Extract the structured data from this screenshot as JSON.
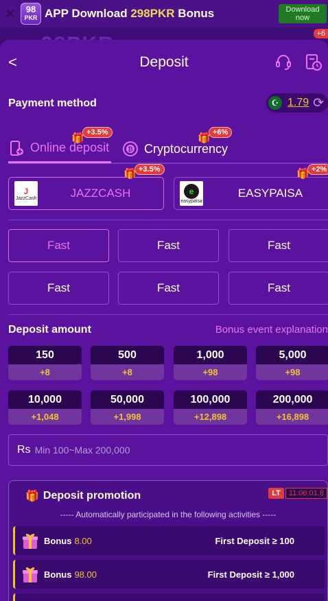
{
  "appbar": {
    "logo_top": "98",
    "logo_bottom": "PKR",
    "title_prefix": "APP Download ",
    "title_highlight": "298PKR",
    "title_suffix": " Bonus",
    "download_button": "Download now"
  },
  "backdrop": {
    "brand": "98PKR",
    "badge": "+6"
  },
  "header": {
    "title": "Deposit"
  },
  "payment": {
    "label": "Payment method",
    "rate": "1.79"
  },
  "methods": [
    {
      "label": "Online deposit",
      "badge": "+3.5%",
      "active": true
    },
    {
      "label": "Cryptocurrency",
      "badge": "+6%",
      "active": false
    }
  ],
  "channels": [
    {
      "name": "JAZZCASH",
      "logo_text": "JazzCash",
      "badge": "+3.5%"
    },
    {
      "name": "EASYPAISA",
      "logo_text": "easypaisa",
      "badge": "+2%"
    }
  ],
  "speeds": [
    "Fast",
    "Fast",
    "Fast",
    "Fast",
    "Fast",
    "Fast"
  ],
  "deposit_amount": {
    "label": "Deposit amount",
    "link": "Bonus event explanation",
    "options": [
      {
        "value": "150",
        "bonus": "+8"
      },
      {
        "value": "500",
        "bonus": "+8"
      },
      {
        "value": "1,000",
        "bonus": "+98"
      },
      {
        "value": "5,000",
        "bonus": "+98"
      },
      {
        "value": "10,000",
        "bonus": "+1,048"
      },
      {
        "value": "50,000",
        "bonus": "+1,998"
      },
      {
        "value": "100,000",
        "bonus": "+12,898"
      },
      {
        "value": "200,000",
        "bonus": "+16,898"
      }
    ]
  },
  "amount_input": {
    "currency": "Rs",
    "placeholder": "Min 100~Max 200,000"
  },
  "promotion": {
    "title": "Deposit promotion",
    "timer_label": "LT",
    "timer": "11:06:01.8",
    "subtitle": "----- Automatically participated in the following activities -----",
    "rows": [
      {
        "label": "Bonus",
        "value": "8.00",
        "condition": "First Deposit ≥ 100"
      },
      {
        "label": "Bonus",
        "value": "98.00",
        "condition": "First Deposit ≥ 1,000"
      }
    ]
  },
  "colors": {
    "background": "#5b139f",
    "accent_pink": "#e873ee",
    "gold": "#f2c230",
    "badge_red": "#e23b3b"
  }
}
